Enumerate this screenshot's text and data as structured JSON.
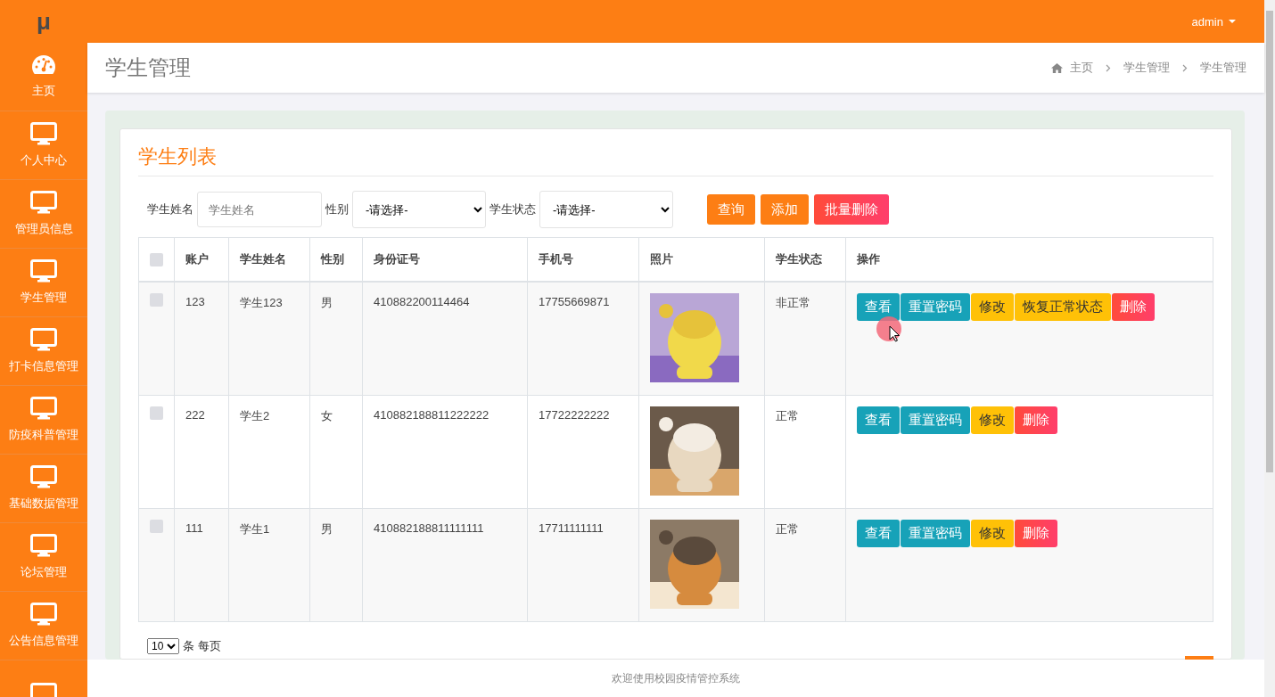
{
  "sidebar": {
    "logo": "μ",
    "items": [
      {
        "kind": "home",
        "label": "主页"
      },
      {
        "kind": "module",
        "label": "个人中心"
      },
      {
        "kind": "module",
        "label": "管理员信息"
      },
      {
        "kind": "module",
        "label": "学生管理"
      },
      {
        "kind": "module",
        "label": "打卡信息管理"
      },
      {
        "kind": "module",
        "label": "防疫科普管理"
      },
      {
        "kind": "module",
        "label": "基础数据管理"
      },
      {
        "kind": "module",
        "label": "论坛管理"
      },
      {
        "kind": "module",
        "label": "公告信息管理"
      },
      {
        "kind": "module"
      }
    ]
  },
  "top_bar": {
    "user": "admin"
  },
  "page_header": {
    "title": "学生管理",
    "breadcrumb": [
      "主页",
      "学生管理",
      "学生管理"
    ]
  },
  "card": {
    "title": "学生列表",
    "filters": [
      {
        "kind": "text",
        "label": "学生姓名",
        "placeholder": "学生姓名"
      },
      {
        "kind": "select",
        "label": "性别",
        "value": "-请选择-"
      },
      {
        "kind": "select",
        "label": "学生状态",
        "value": "-请选择-"
      }
    ],
    "toolbar": [
      {
        "label": "查询",
        "kind": "primary"
      },
      {
        "label": "添加",
        "kind": "primary"
      },
      {
        "label": "批量删除",
        "kind": "danger"
      }
    ],
    "table": {
      "select_all": {
        "checked": false
      },
      "columns": [
        "账户",
        "学生姓名",
        "性别",
        "身份证号",
        "手机号",
        "照片",
        "学生状态",
        "操作"
      ],
      "rows": [
        {
          "checked": false,
          "account": "123",
          "name": "学生123",
          "gender": "男",
          "id_number": "410882200114464",
          "phone": "17755669871",
          "photo": {
            "kind": "picture"
          },
          "status": "非正常",
          "actions": [
            {
              "label": "查看",
              "kind": "info"
            },
            {
              "label": "重置密码",
              "kind": "info"
            },
            {
              "label": "修改",
              "kind": "warning"
            },
            {
              "label": "恢复正常状态",
              "kind": "warning"
            },
            {
              "label": "删除",
              "kind": "danger"
            }
          ]
        },
        {
          "checked": false,
          "account": "222",
          "name": "学生2",
          "gender": "女",
          "id_number": "410882188811222222",
          "phone": "17722222222",
          "photo": {
            "kind": "picture"
          },
          "status": "正常",
          "actions": [
            {
              "label": "查看",
              "kind": "info"
            },
            {
              "label": "重置密码",
              "kind": "info"
            },
            {
              "label": "修改",
              "kind": "warning"
            },
            {
              "label": "删除",
              "kind": "danger"
            }
          ]
        },
        {
          "checked": false,
          "account": "111",
          "name": "学生1",
          "gender": "男",
          "id_number": "410882188811111111",
          "phone": "17711111111",
          "photo": {
            "kind": "picture"
          },
          "status": "正常",
          "actions": [
            {
              "label": "查看",
              "kind": "info"
            },
            {
              "label": "重置密码",
              "kind": "info"
            },
            {
              "label": "修改",
              "kind": "warning"
            },
            {
              "label": "删除",
              "kind": "danger"
            }
          ]
        }
      ]
    },
    "pagination": {
      "page_size": "10",
      "page_size_label": "条 每页"
    }
  },
  "footer": "欢迎使用校园疫情管控系统"
}
